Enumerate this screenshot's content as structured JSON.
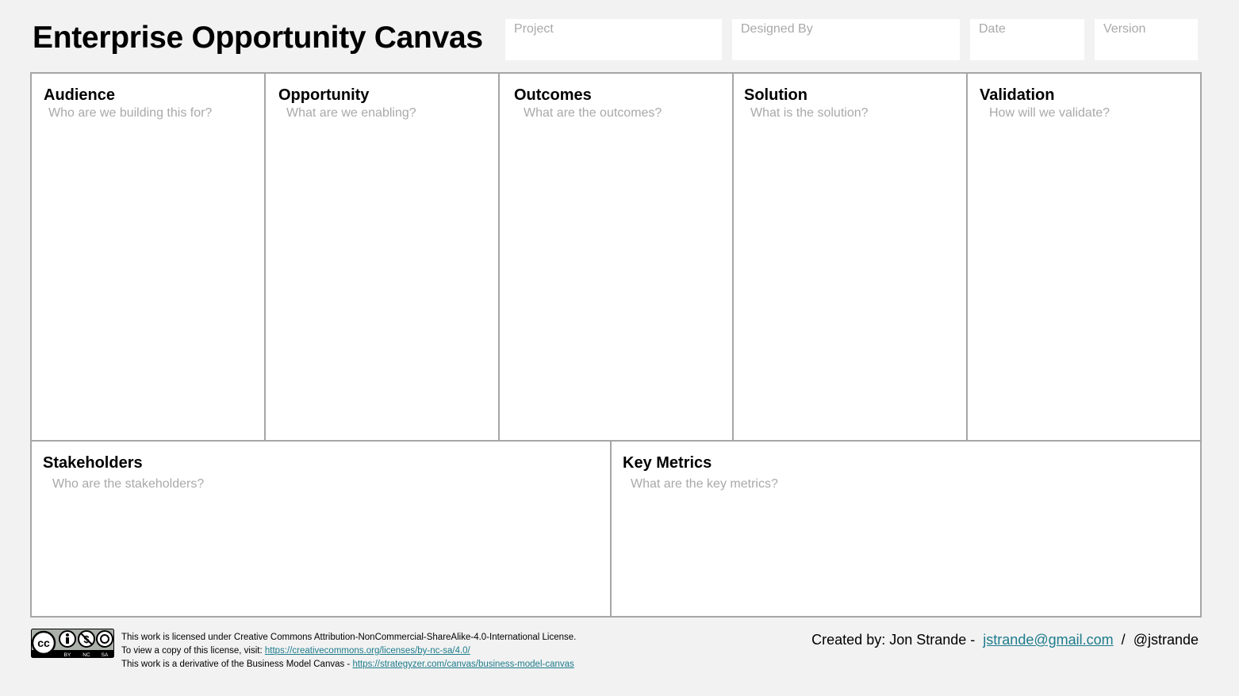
{
  "title": "Enterprise Opportunity Canvas",
  "meta": {
    "project": "Project",
    "designed_by": "Designed By",
    "date": "Date",
    "version": "Version"
  },
  "sections": {
    "audience": {
      "title": "Audience",
      "prompt": "Who are we building this for?"
    },
    "opportunity": {
      "title": "Opportunity",
      "prompt": "What are we enabling?"
    },
    "outcomes": {
      "title": "Outcomes",
      "prompt": "What are the outcomes?"
    },
    "solution": {
      "title": "Solution",
      "prompt": "What is the solution?"
    },
    "validation": {
      "title": "Validation",
      "prompt": "How will we validate?"
    },
    "stakeholders": {
      "title": "Stakeholders",
      "prompt": "Who are the stakeholders?"
    },
    "key_metrics": {
      "title": "Key Metrics",
      "prompt": "What are the key metrics?"
    }
  },
  "license": {
    "badge_labels": [
      "BY",
      "NC",
      "SA"
    ],
    "line1": "This work is licensed under Creative Commons Attribution-NonCommercial-ShareAlike-4.0-International License.",
    "line2_prefix": "To view a copy of this license, visit: ",
    "line2_link": "https://creativecommons.org/licenses/by-nc-sa/4.0/",
    "line3_prefix": "This work is a derivative of the Business Model Canvas - ",
    "line3_link": "https://strategyzer.com/canvas/business-model-canvas"
  },
  "credit": {
    "prefix": "Created by: Jon Strande - ",
    "email": "jstrande@gmail.com",
    "separator": " / ",
    "handle": "@jstrande"
  },
  "colors": {
    "background": "#f2f2f2",
    "border": "#a6a6a6",
    "placeholder": "#a9a9a9",
    "link": "#1d7c8c"
  }
}
